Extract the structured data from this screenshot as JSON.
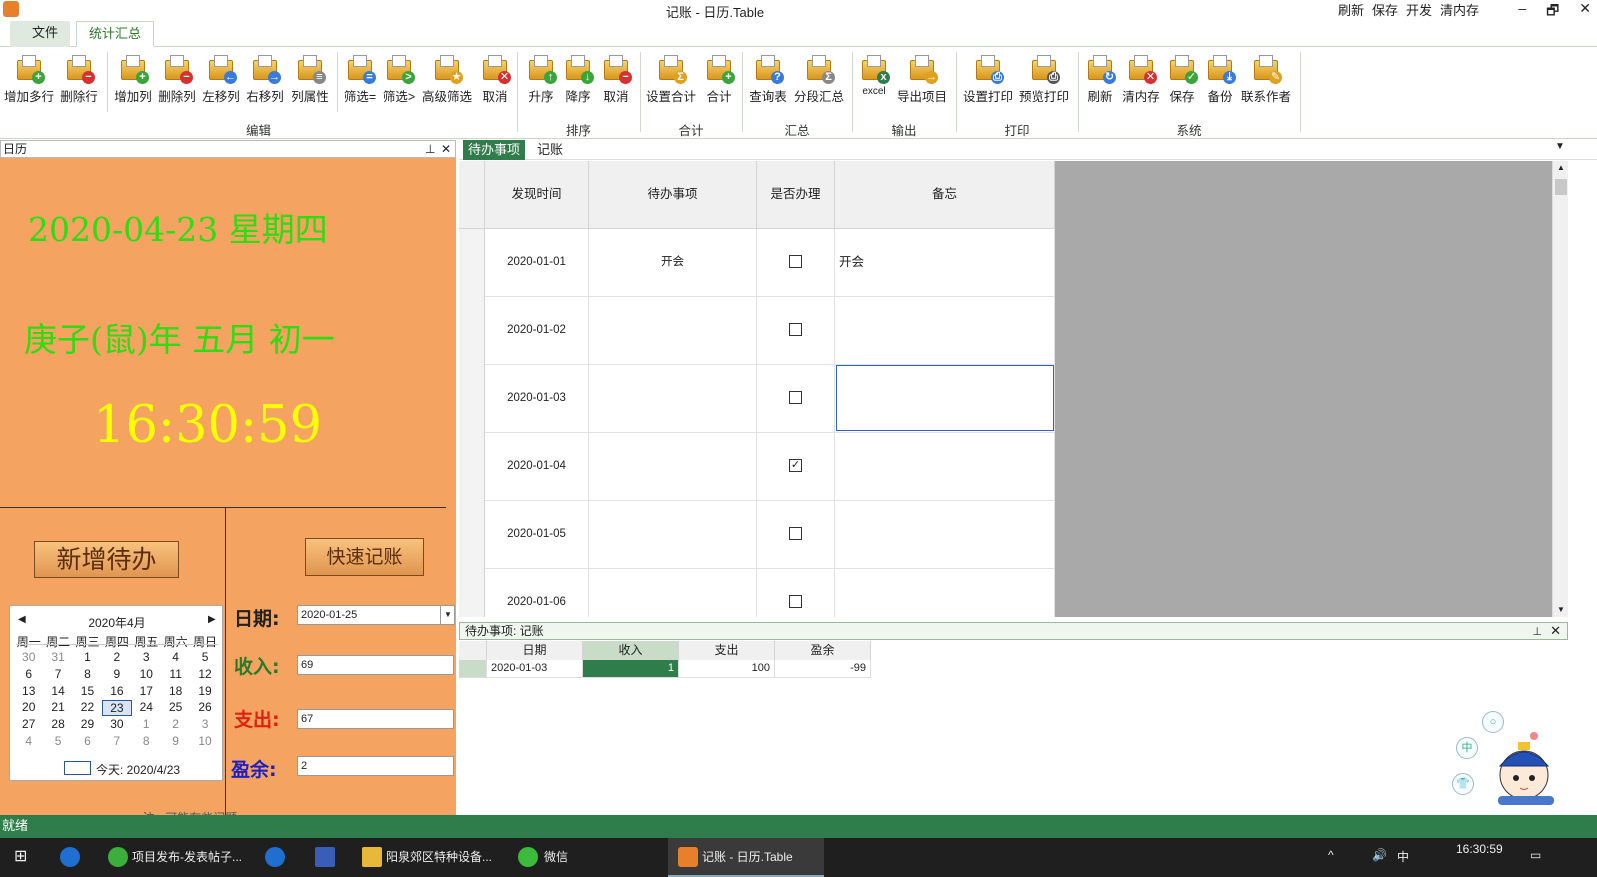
{
  "window": {
    "title": "记账 - 日历.Table",
    "quick_actions": [
      "刷新",
      "保存",
      "开发",
      "清内存"
    ],
    "minimize": "–",
    "restore": "🗗",
    "close": "✕"
  },
  "tabs": {
    "file": "文件",
    "stats": "统计汇总"
  },
  "ribbon": {
    "buttons": [
      "增加多行",
      "删除行",
      "增加列",
      "删除列",
      "左移列",
      "右移列",
      "列属性",
      "筛选=",
      "筛选>",
      "高级筛选",
      "取消",
      "升序",
      "降序",
      "取消",
      "设置合计",
      "合计",
      "查询表",
      "分段汇总",
      "excel",
      "导出项目",
      "设置打印",
      "预览打印",
      "刷新",
      "清内存",
      "保存",
      "备份",
      "联系作者"
    ],
    "groups": [
      "编辑",
      "排序",
      "合计",
      "汇总",
      "输出",
      "打印",
      "系统"
    ]
  },
  "left_panel": {
    "header": "日历",
    "pin": "ᵖ",
    "close": "✕",
    "date_text": "2020-04-23  星期四",
    "lunar_text": "庚子(鼠)年 五月 初一",
    "clock": "16:30:59",
    "add_todo_button": "新增待办",
    "quick_account_button": "快速记账",
    "calendar": {
      "title": "2020年4月",
      "prev": "◀",
      "next": "▶",
      "weekdays": [
        "周一",
        "周二",
        "周三",
        "周四",
        "周五",
        "周六",
        "周日"
      ],
      "weeks": [
        [
          "30",
          "31",
          "1",
          "2",
          "3",
          "4",
          "5"
        ],
        [
          "6",
          "7",
          "8",
          "9",
          "10",
          "11",
          "12"
        ],
        [
          "13",
          "14",
          "15",
          "16",
          "17",
          "18",
          "19"
        ],
        [
          "20",
          "21",
          "22",
          "23",
          "24",
          "25",
          "26"
        ],
        [
          "27",
          "28",
          "29",
          "30",
          "1",
          "2",
          "3"
        ],
        [
          "4",
          "5",
          "6",
          "7",
          "8",
          "9",
          "10"
        ]
      ],
      "today_label": "今天: 2020/4/23"
    },
    "form": {
      "date_label": "日期:",
      "date_value": "2020-01-25",
      "income_label": "收入:",
      "income_value": "69",
      "expense_label": "支出:",
      "expense_value": "67",
      "balance_label": "盈余:",
      "balance_value": "2",
      "bottom_partial": "· · · · · · · · · · · · · · 注 · 可能有些问题 · ·"
    }
  },
  "doc_tabs": [
    "待办事项",
    "记账"
  ],
  "todo_grid": {
    "headers": [
      "发现时间",
      "待办事项",
      "是否办理",
      "备忘"
    ],
    "rows": [
      {
        "date": "2020-01-01",
        "item": "开会",
        "done": false,
        "memo": "开会"
      },
      {
        "date": "2020-01-02",
        "item": "",
        "done": false,
        "memo": ""
      },
      {
        "date": "2020-01-03",
        "item": "",
        "done": false,
        "memo": ""
      },
      {
        "date": "2020-01-04",
        "item": "",
        "done": true,
        "memo": ""
      },
      {
        "date": "2020-01-05",
        "item": "",
        "done": false,
        "memo": ""
      },
      {
        "date": "2020-01-06",
        "item": "",
        "done": false,
        "memo": ""
      }
    ]
  },
  "bottom_panel": {
    "header": "待办事项: 记账",
    "headers": [
      "日期",
      "收入",
      "支出",
      "盈余"
    ],
    "row": {
      "date": "2020-01-03",
      "income": "1",
      "expense": "100",
      "balance": "-99"
    }
  },
  "status": "就绪",
  "taskbar": {
    "items": [
      "项目发布-发表帖子...",
      "阳泉郊区特种设备...",
      "微信",
      "记账 - 日历.Table"
    ],
    "time": "16:30:59",
    "ime": "中"
  },
  "colors": {
    "left_bg": "#f4a460",
    "green_text": "#2ddc11",
    "clock": "#ffff00",
    "accent": "#2f7d4a",
    "income_label": "#2a7a2a",
    "expense_label": "#e02010",
    "balance_label": "#2020c0"
  }
}
